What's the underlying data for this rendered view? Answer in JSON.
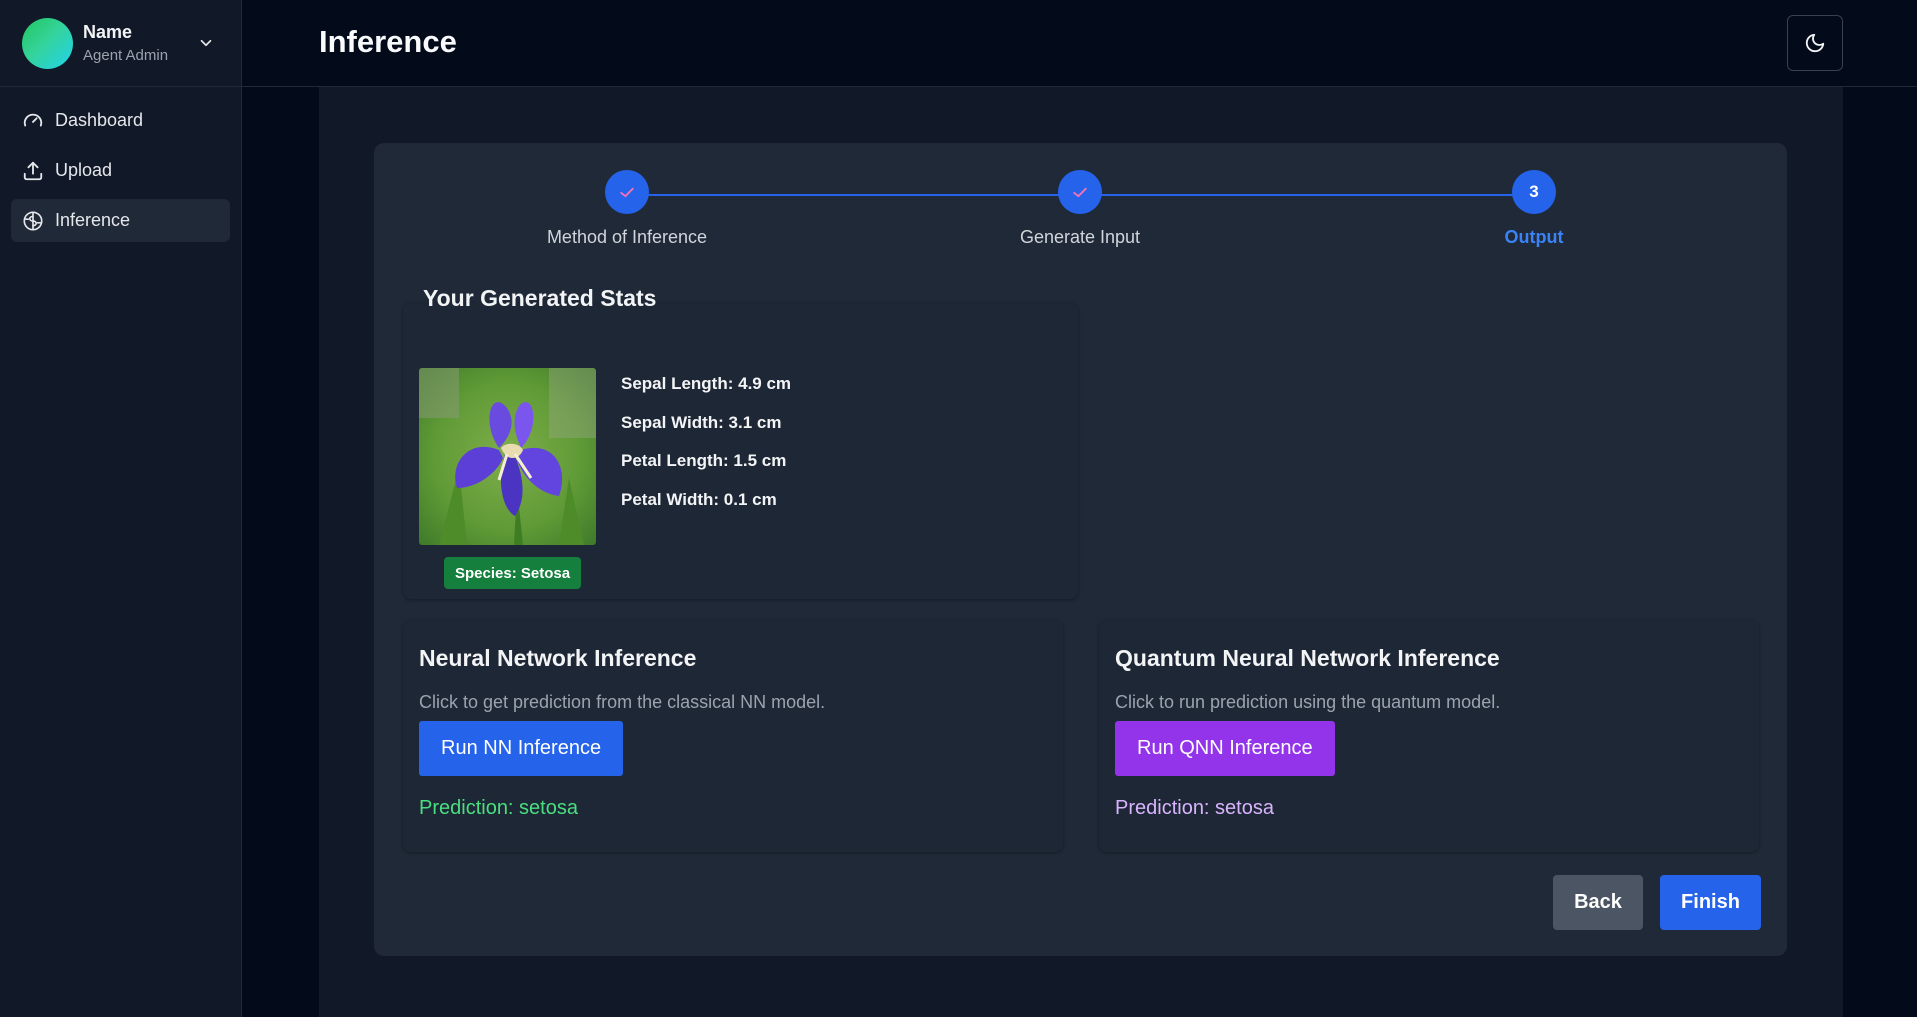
{
  "sidebar": {
    "user_name": "Name",
    "user_role": "Agent Admin",
    "items": [
      {
        "label": "Dashboard",
        "icon": "gauge-icon"
      },
      {
        "label": "Upload",
        "icon": "upload-icon"
      },
      {
        "label": "Inference",
        "icon": "brain-icon",
        "active": true
      }
    ]
  },
  "header": {
    "title": "Inference",
    "theme_toggle_icon": "moon-icon"
  },
  "stepper": {
    "steps": [
      {
        "label": "Method of Inference",
        "state": "complete"
      },
      {
        "label": "Generate Input",
        "state": "complete"
      },
      {
        "label": "Output",
        "number": "3",
        "state": "current"
      }
    ]
  },
  "stats": {
    "title": "Your Generated Stats",
    "lines": [
      "Sepal Length: 4.9 cm",
      "Sepal Width: 3.1 cm",
      "Petal Length: 1.5 cm",
      "Petal Width: 0.1 cm"
    ],
    "species": "Species: Setosa"
  },
  "nn": {
    "title": "Neural Network Inference",
    "description": "Click to get prediction from the classical NN model.",
    "button": "Run NN Inference",
    "prediction": "Prediction: setosa"
  },
  "qnn": {
    "title": "Quantum Neural Network Inference",
    "description": "Click to run prediction using the quantum model.",
    "button": "Run QNN Inference",
    "prediction": "Prediction: setosa"
  },
  "footer": {
    "back": "Back",
    "finish": "Finish"
  },
  "colors": {
    "accent": "#2563eb",
    "qnn_accent": "#9333ea",
    "species_badge": "#15803d",
    "nn_prediction": "#4ade80",
    "qnn_prediction": "#d8b4fe"
  }
}
